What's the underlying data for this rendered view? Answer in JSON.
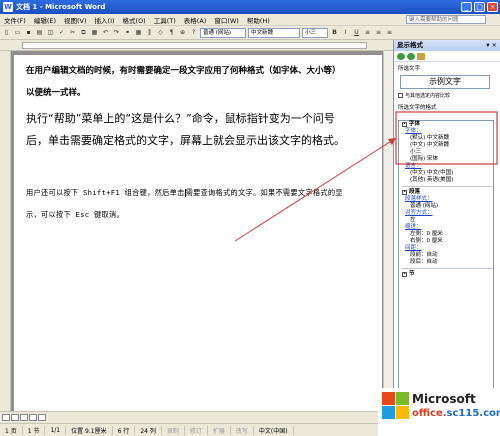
{
  "window": {
    "title": "文档 1 - Microsoft Word"
  },
  "menu": {
    "items": [
      "文件(F)",
      "编辑(E)",
      "视图(V)",
      "插入(I)",
      "格式(O)",
      "工具(T)",
      "表格(A)",
      "窗口(W)",
      "帮助(H)"
    ],
    "help_placeholder": "键入需要帮助的问题"
  },
  "toolbar": {
    "style_value": "普通 (网站)",
    "font_value": "中文新魏",
    "size_value": "小三",
    "bold": "B",
    "italic": "I",
    "underline": "U"
  },
  "document": {
    "para1": "在用户编辑文档的时候，有时需要确定一段文字应用了何种格式（如字体、大小等）以便统一式样。",
    "para2": "执行“帮助”菜单上的“这是什么？”命令，鼠标指针变为一个问号后，单击需要确定格式的文字，屏幕上就会显示出该文字的格式。",
    "para3_before": "用户还可以按下 Shift+F1 组合键，然后单击",
    "para3_after": "需要查询格式的文字。如果不需要文字格式的显示，可以按下 Esc 键取消。"
  },
  "pane": {
    "title": "显示格式",
    "selected_label": "所选文字",
    "sample": "示例文字",
    "compare_label": "与其他选定内容比较",
    "format_label": "所选文字的格式",
    "font_section": {
      "heading": "字体",
      "link": "字体：",
      "values": [
        "(默认) 中文新魏",
        "(中文) 中文新魏",
        "小三",
        "(国际) 宋体"
      ],
      "lang_link": "语言：",
      "lang_values": [
        "(中文) 中文(中国)",
        "(其他) 英语(美国)"
      ]
    },
    "para_section": {
      "heading": "段落",
      "style_link": "段落样式：",
      "style_value": "普通 (网站)",
      "align_link": "对齐方式：",
      "align_value": "左",
      "indent_link": "缩进：",
      "indent_values": [
        "左侧：0 厘米",
        "右侧：0 厘米"
      ],
      "spacing_link": "间距：",
      "spacing_values": [
        "段前：自动",
        "段后：自动"
      ]
    },
    "section_section": {
      "heading": "节"
    }
  },
  "statusbar": {
    "page": "1 页",
    "section": "1 节",
    "pages": "1/1",
    "position": "位置 9.1厘米",
    "line": "6 行",
    "col": "24 列",
    "rec": "录制",
    "trk": "修订",
    "ext": "扩展",
    "ovr": "改写",
    "language": "中文(中国)"
  },
  "watermark": {
    "brand": "Microsoft",
    "site_a": "office.",
    "site_b": "sc115.com"
  },
  "colors": {
    "annotation": "#d23b3b",
    "titlebar": "#2360d8"
  }
}
